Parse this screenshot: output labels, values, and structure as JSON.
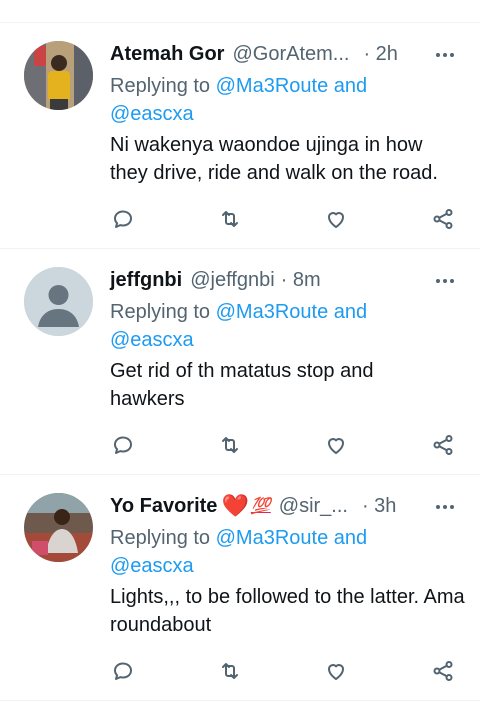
{
  "tweets": [
    {
      "name": "Atemah Gor",
      "handle": "@GorAtem...",
      "time": "· 2h",
      "replying_prefix": "Replying to ",
      "mention1": "@Ma3Route and",
      "mention2": "@eascxa",
      "text": "Ni wakenya waondoe ujinga in how they drive, ride and walk on the road.",
      "avatar_color": "#c9a227"
    },
    {
      "name": "jeffgnbi",
      "handle": "@jeffgnbi",
      "time": "· 8m",
      "replying_prefix": "Replying to ",
      "mention1": "@Ma3Route and",
      "mention2": "@eascxa",
      "text": "Get rid of th matatus stop and hawkers",
      "avatar_color": "#ccd6dd"
    },
    {
      "name": "Yo Favorite",
      "name_emoji_heart": "❤️",
      "name_emoji_100": "💯",
      "handle": "@sir_...",
      "time": "· 3h",
      "replying_prefix": "Replying to ",
      "mention1": "@Ma3Route and",
      "mention2": "@eascxa",
      "text": "Lights,,, to be followed to the latter. Ama roundabout",
      "avatar_color": "#8a6a58"
    }
  ],
  "colors": {
    "accent": "#1d9bf0",
    "secondary_text": "#536471",
    "divider": "#eff3f4"
  },
  "icons": [
    "reply-icon",
    "retweet-icon",
    "like-icon",
    "share-icon",
    "more-icon"
  ]
}
